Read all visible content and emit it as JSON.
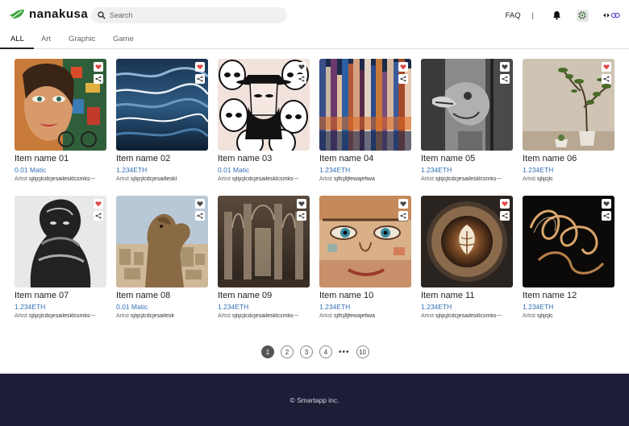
{
  "brand": {
    "name": "nanakusa",
    "accent": "#3aa53a"
  },
  "search": {
    "placeholder": "Search"
  },
  "header": {
    "faq": "FAQ",
    "separator": "|",
    "icons": [
      "bell-icon",
      "chip-icon",
      "wallet-link-icon"
    ]
  },
  "tabs": [
    {
      "label": "ALL",
      "active": true
    },
    {
      "label": "Art",
      "active": false
    },
    {
      "label": "Graphic",
      "active": false
    },
    {
      "label": "Game",
      "active": false
    }
  ],
  "artist_label": "Artist",
  "items": [
    {
      "name": "Item name 01",
      "price": "0.01 Matic",
      "artist": "sjlijcjlcdcjesailesklcsmks---",
      "liked": true
    },
    {
      "name": "Item name 02",
      "price": "1.234ETH",
      "artist": "sjlijcjlcdcjesailleskl",
      "liked": true
    },
    {
      "name": "Item name 03",
      "price": "0.01 Matic",
      "artist": "sjlijcjlcdcjesailesklcsmks---",
      "liked": false
    },
    {
      "name": "Item name 04",
      "price": "1.234ETH",
      "artist": "sjlfcjlljfewajefiwa",
      "liked": true
    },
    {
      "name": "Item name 05",
      "price": "1.234ETH",
      "artist": "sjlijcjlcdcjesailesklcsmks---",
      "liked": false
    },
    {
      "name": "Item name 06",
      "price": "1.234ETH",
      "artist": "sjlijcjlc",
      "liked": true
    },
    {
      "name": "Item name 07",
      "price": "1.234ETH",
      "artist": "sjlijcjlcdcjesailesklcsmks---",
      "liked": true
    },
    {
      "name": "Item name 08",
      "price": "0.01 Matic",
      "artist": "sjlijcjlcdcjesailesk",
      "liked": false
    },
    {
      "name": "Item name 09",
      "price": "1.234ETH",
      "artist": "sjlijcjlcdcjesailesklcsmks---",
      "liked": false
    },
    {
      "name": "Item name 10",
      "price": "1.234ETH",
      "artist": "sjlfcjlljfewajefiwa",
      "liked": false
    },
    {
      "name": "Item name 11",
      "price": "1.234ETH",
      "artist": "sjlijcjlcdcjesailesklcsmks---",
      "liked": true
    },
    {
      "name": "Item name 12",
      "price": "1.234ETH",
      "artist": "sjlijcjlc",
      "liked": false
    }
  ],
  "pagination": {
    "pages": [
      "1",
      "2",
      "3",
      "4"
    ],
    "ellipsis": "•••",
    "last": "10",
    "current": "1"
  },
  "footer": {
    "copyright": "© Smartapp inc."
  },
  "colors": {
    "price": "#2f6eb5",
    "like_active": "#e04848",
    "like_inactive": "#444444",
    "footer_bg": "#1c1e38"
  }
}
